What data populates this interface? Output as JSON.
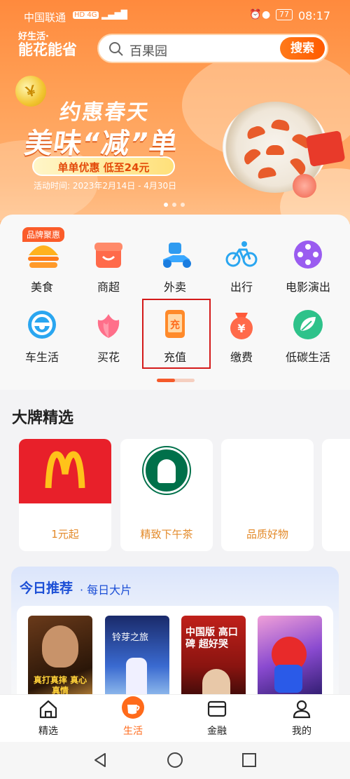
{
  "status_bar": {
    "carrier": "中国联通",
    "network": "HD 4G",
    "battery": "77",
    "time": "08:17"
  },
  "header": {
    "brand_line1": "好生活·",
    "brand_line2": "能花能省",
    "search_value": "百果园",
    "search_button": "搜索"
  },
  "banner": {
    "title1": "约惠春天",
    "title2": "美味“减”单",
    "pill": "单单优惠 低至24元",
    "date": "活动时间: 2023年2月14日 - 4月30日"
  },
  "grid": {
    "tag": "品牌聚惠",
    "row1": [
      "美食",
      "商超",
      "外卖",
      "出行",
      "电影演出"
    ],
    "row2": [
      "车生活",
      "买花",
      "充值",
      "缴费",
      "低碳生活"
    ]
  },
  "brands": {
    "title": "大牌精选",
    "cards": [
      "1元起",
      "精致下午茶",
      "品质好物"
    ]
  },
  "recommend": {
    "title": "今日推荐",
    "subtitle": "· 每日大片",
    "posters": [
      "真打真摔 真心真情",
      "铃芽之旅",
      "中国版 高口碑 超好哭",
      ""
    ]
  },
  "tabs": [
    "精选",
    "生活",
    "金融",
    "我的"
  ],
  "colors": {
    "accent": "#ff6a1a",
    "active_tab": "#ff6a1a"
  }
}
